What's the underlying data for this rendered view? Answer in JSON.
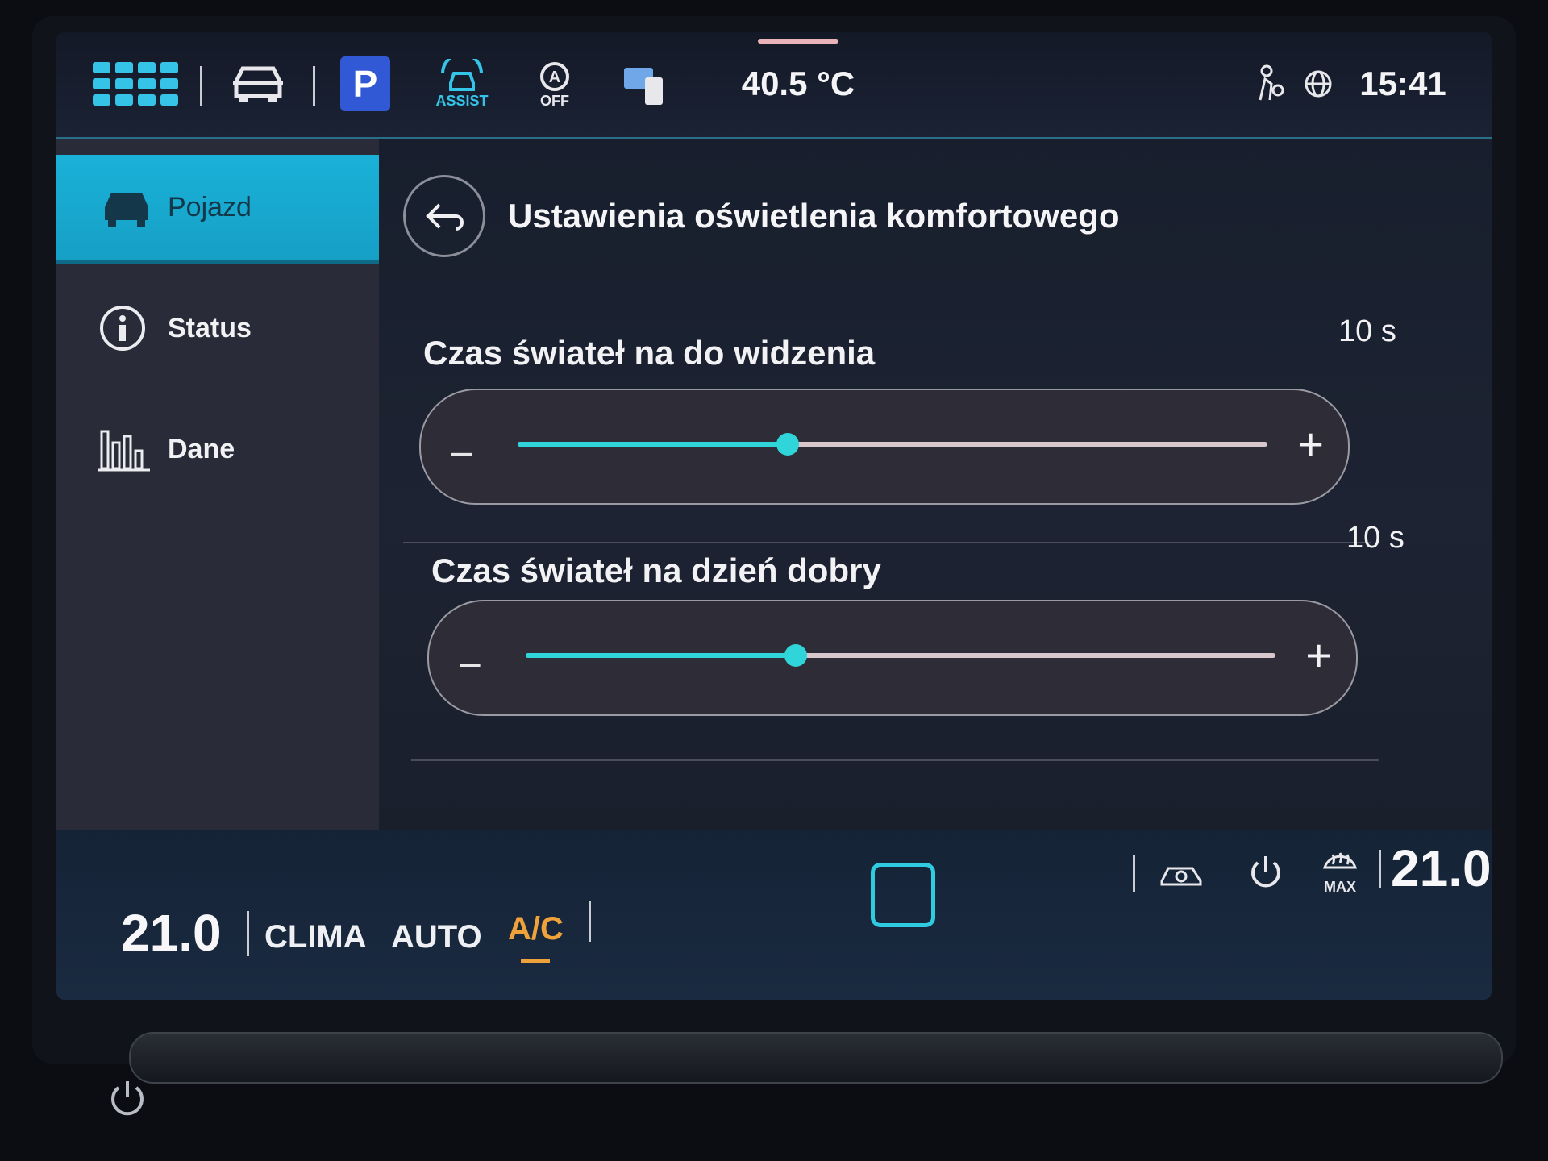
{
  "top_bar": {
    "apps_icon": "apps-grid-icon",
    "vehicle_icon": "car-front-icon",
    "park_label": "P",
    "assist_label": "ASSIST",
    "auto_hold_label": "OFF",
    "outside_temp": "40.5 °C",
    "clock": "15:41"
  },
  "sidebar": {
    "items": [
      {
        "label": "Pojazd",
        "icon": "car-icon",
        "active": true
      },
      {
        "label": "Status",
        "icon": "info-icon",
        "active": false
      },
      {
        "label": "Dane",
        "icon": "bar-chart-icon",
        "active": false
      }
    ]
  },
  "page": {
    "title": "Ustawienia oświetlenia komfortowego",
    "settings": [
      {
        "label": "Czas świateł na do widzenia",
        "value": "10 s",
        "level_fraction": 0.36
      },
      {
        "label": "Czas świateł na dzień dobry",
        "value": "10 s",
        "level_fraction": 0.36
      }
    ],
    "minus_symbol": "–",
    "plus_symbol": "+"
  },
  "climate": {
    "left_temp": "21.0",
    "right_temp": "21.0",
    "clima_label": "CLIMA",
    "auto_label": "AUTO",
    "ac_label": "A/C",
    "defrost_label": "MAX",
    "accent_color": "#2fd5d8",
    "ac_color": "#f0a23a"
  }
}
